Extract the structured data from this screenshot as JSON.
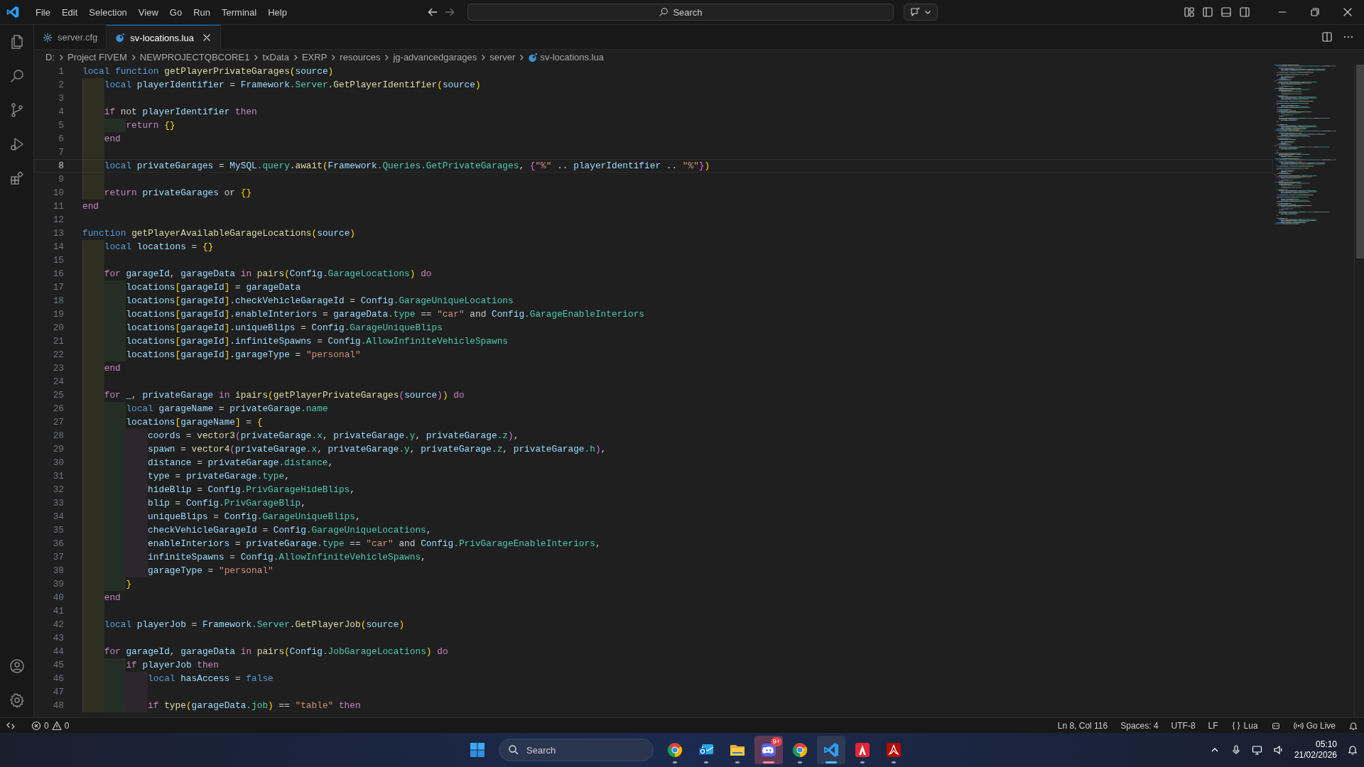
{
  "title_bar": {
    "menu": [
      "File",
      "Edit",
      "Selection",
      "View",
      "Go",
      "Run",
      "Terminal",
      "Help"
    ],
    "command_center": {
      "label": "Search"
    }
  },
  "tabs": [
    {
      "label": "server.cfg",
      "kind": "config",
      "selected": false
    },
    {
      "label": "sv-locations.lua",
      "kind": "lua",
      "selected": true
    }
  ],
  "breadcrumbs": [
    {
      "label": "D:",
      "kind": "folder"
    },
    {
      "label": "Project FIVEM",
      "kind": "folder"
    },
    {
      "label": "NEWPROJECTQBCORE1",
      "kind": "folder"
    },
    {
      "label": "txData",
      "kind": "folder"
    },
    {
      "label": "EXRP",
      "kind": "folder"
    },
    {
      "label": "resources",
      "kind": "folder"
    },
    {
      "label": "jg-advancedgarages",
      "kind": "folder"
    },
    {
      "label": "server",
      "kind": "folder"
    },
    {
      "label": "sv-locations.lua",
      "kind": "lua"
    }
  ],
  "editor": {
    "lines": [
      {
        "number": "1",
        "current": false,
        "tokens": [
          {
            "text": "local ",
            "kind": "kw"
          },
          {
            "text": "function ",
            "kind": "kw"
          },
          {
            "text": "getPlayerPrivateGarages",
            "kind": "fn"
          },
          {
            "text": "(",
            "kind": "b1"
          },
          {
            "text": "source",
            "kind": "var"
          },
          {
            "text": ")",
            "kind": "b1"
          }
        ]
      },
      {
        "number": "2",
        "current": false,
        "tokens": [
          {
            "text": "    local ",
            "kind": "kw"
          },
          {
            "text": "playerIdentifier",
            "kind": "var"
          },
          {
            "text": " = ",
            "kind": "op"
          },
          {
            "text": "Framework",
            "kind": "var"
          },
          {
            "text": ".Server",
            "kind": "prop"
          },
          {
            "text": ".GetPlayerIdentifier",
            "kind": "fn"
          },
          {
            "text": "(",
            "kind": "b1"
          },
          {
            "text": "source",
            "kind": "var"
          },
          {
            "text": ")",
            "kind": "b1"
          }
        ]
      },
      {
        "number": "3",
        "current": false
      },
      {
        "number": "4",
        "current": false,
        "tokens": [
          {
            "text": "    if ",
            "kind": "ctl"
          },
          {
            "text": "not ",
            "kind": "op"
          },
          {
            "text": "playerIdentifier ",
            "kind": "var"
          },
          {
            "text": "then",
            "kind": "ctl"
          }
        ]
      },
      {
        "number": "5",
        "current": false,
        "tokens": [
          {
            "text": "        return ",
            "kind": "ctl"
          },
          {
            "text": "{}",
            "kind": "b1"
          }
        ]
      },
      {
        "number": "6",
        "current": false,
        "tokens": [
          {
            "text": "    end",
            "kind": "ctl"
          }
        ]
      },
      {
        "number": "7",
        "current": false
      },
      {
        "number": "8",
        "current": true,
        "tokens": [
          {
            "text": "    local ",
            "kind": "kw"
          },
          {
            "text": "privateGarages",
            "kind": "var"
          },
          {
            "text": " = ",
            "kind": "op"
          },
          {
            "text": "MySQL",
            "kind": "var"
          },
          {
            "text": ".query",
            "kind": "prop"
          },
          {
            "text": ".await",
            "kind": "fn"
          },
          {
            "text": "(",
            "kind": "b1"
          },
          {
            "text": "Framework",
            "kind": "var"
          },
          {
            "text": ".Queries",
            "kind": "prop"
          },
          {
            "text": ".GetPrivateGarages",
            "kind": "prop"
          },
          {
            "text": ", ",
            "kind": "op"
          },
          {
            "text": "{",
            "kind": "b2"
          },
          {
            "text": "\"%\"",
            "kind": "str"
          },
          {
            "text": " .. ",
            "kind": "op"
          },
          {
            "text": "playerIdentifier",
            "kind": "var"
          },
          {
            "text": " .. ",
            "kind": "op"
          },
          {
            "text": "\"%\"",
            "kind": "str"
          },
          {
            "text": "}",
            "kind": "b2"
          },
          {
            "text": ")",
            "kind": "b1"
          }
        ]
      },
      {
        "number": "9",
        "current": false
      },
      {
        "number": "10",
        "current": false,
        "tokens": [
          {
            "text": "    return ",
            "kind": "ctl"
          },
          {
            "text": "privateGarages ",
            "kind": "var"
          },
          {
            "text": "or ",
            "kind": "op"
          },
          {
            "text": "{}",
            "kind": "b1"
          }
        ]
      },
      {
        "number": "11",
        "current": false,
        "tokens": [
          {
            "text": "end",
            "kind": "ctl"
          }
        ]
      },
      {
        "number": "12",
        "current": false
      },
      {
        "number": "13",
        "current": false,
        "tokens": [
          {
            "text": "function ",
            "kind": "kw"
          },
          {
            "text": "getPlayerAvailableGarageLocations",
            "kind": "fn"
          },
          {
            "text": "(",
            "kind": "b1"
          },
          {
            "text": "source",
            "kind": "var"
          },
          {
            "text": ")",
            "kind": "b1"
          }
        ]
      },
      {
        "number": "14",
        "current": false,
        "tokens": [
          {
            "text": "    local ",
            "kind": "kw"
          },
          {
            "text": "locations",
            "kind": "var"
          },
          {
            "text": " = ",
            "kind": "op"
          },
          {
            "text": "{}",
            "kind": "b1"
          }
        ]
      },
      {
        "number": "15",
        "current": false
      },
      {
        "number": "16",
        "current": false,
        "tokens": [
          {
            "text": "    for ",
            "kind": "ctl"
          },
          {
            "text": "garageId",
            "kind": "var"
          },
          {
            "text": ", ",
            "kind": "op"
          },
          {
            "text": "garageData ",
            "kind": "var"
          },
          {
            "text": "in ",
            "kind": "ctl"
          },
          {
            "text": "pairs",
            "kind": "fn"
          },
          {
            "text": "(",
            "kind": "b1"
          },
          {
            "text": "Config",
            "kind": "var"
          },
          {
            "text": ".GarageLocations",
            "kind": "prop"
          },
          {
            "text": ") ",
            "kind": "b1"
          },
          {
            "text": "do",
            "kind": "ctl"
          }
        ]
      },
      {
        "number": "17",
        "current": false,
        "tokens": [
          {
            "text": "        locations",
            "kind": "var"
          },
          {
            "text": "[",
            "kind": "b1"
          },
          {
            "text": "garageId",
            "kind": "var"
          },
          {
            "text": "]",
            "kind": "b1"
          },
          {
            "text": " = ",
            "kind": "op"
          },
          {
            "text": "garageData",
            "kind": "var"
          }
        ]
      },
      {
        "number": "18",
        "current": false,
        "tokens": [
          {
            "text": "        locations",
            "kind": "var"
          },
          {
            "text": "[",
            "kind": "b1"
          },
          {
            "text": "garageId",
            "kind": "var"
          },
          {
            "text": "]",
            "kind": "b1"
          },
          {
            "text": ".checkVehicleGarageId",
            "kind": "var"
          },
          {
            "text": " = ",
            "kind": "op"
          },
          {
            "text": "Config",
            "kind": "var"
          },
          {
            "text": ".GarageUniqueLocations",
            "kind": "prop"
          }
        ]
      },
      {
        "number": "19",
        "current": false,
        "tokens": [
          {
            "text": "        locations",
            "kind": "var"
          },
          {
            "text": "[",
            "kind": "b1"
          },
          {
            "text": "garageId",
            "kind": "var"
          },
          {
            "text": "]",
            "kind": "b1"
          },
          {
            "text": ".enableInteriors",
            "kind": "var"
          },
          {
            "text": " = ",
            "kind": "op"
          },
          {
            "text": "garageData",
            "kind": "var"
          },
          {
            "text": ".type",
            "kind": "prop"
          },
          {
            "text": " == ",
            "kind": "op"
          },
          {
            "text": "\"car\"",
            "kind": "str"
          },
          {
            "text": " and ",
            "kind": "op"
          },
          {
            "text": "Config",
            "kind": "var"
          },
          {
            "text": ".GarageEnableInteriors",
            "kind": "prop"
          }
        ]
      },
      {
        "number": "20",
        "current": false,
        "tokens": [
          {
            "text": "        locations",
            "kind": "var"
          },
          {
            "text": "[",
            "kind": "b1"
          },
          {
            "text": "garageId",
            "kind": "var"
          },
          {
            "text": "]",
            "kind": "b1"
          },
          {
            "text": ".uniqueBlips",
            "kind": "var"
          },
          {
            "text": " = ",
            "kind": "op"
          },
          {
            "text": "Config",
            "kind": "var"
          },
          {
            "text": ".GarageUniqueBlips",
            "kind": "prop"
          }
        ]
      },
      {
        "number": "21",
        "current": false,
        "tokens": [
          {
            "text": "        locations",
            "kind": "var"
          },
          {
            "text": "[",
            "kind": "b1"
          },
          {
            "text": "garageId",
            "kind": "var"
          },
          {
            "text": "]",
            "kind": "b1"
          },
          {
            "text": ".infiniteSpawns",
            "kind": "var"
          },
          {
            "text": " = ",
            "kind": "op"
          },
          {
            "text": "Config",
            "kind": "var"
          },
          {
            "text": ".AllowInfiniteVehicleSpawns",
            "kind": "prop"
          }
        ]
      },
      {
        "number": "22",
        "current": false,
        "tokens": [
          {
            "text": "        locations",
            "kind": "var"
          },
          {
            "text": "[",
            "kind": "b1"
          },
          {
            "text": "garageId",
            "kind": "var"
          },
          {
            "text": "]",
            "kind": "b1"
          },
          {
            "text": ".garageType",
            "kind": "var"
          },
          {
            "text": " = ",
            "kind": "op"
          },
          {
            "text": "\"personal\"",
            "kind": "str"
          }
        ]
      },
      {
        "number": "23",
        "current": false,
        "tokens": [
          {
            "text": "    end",
            "kind": "ctl"
          }
        ]
      },
      {
        "number": "24",
        "current": false
      },
      {
        "number": "25",
        "current": false,
        "tokens": [
          {
            "text": "    for ",
            "kind": "ctl"
          },
          {
            "text": "_",
            "kind": "var"
          },
          {
            "text": ", ",
            "kind": "op"
          },
          {
            "text": "privateGarage ",
            "kind": "var"
          },
          {
            "text": "in ",
            "kind": "ctl"
          },
          {
            "text": "ipairs",
            "kind": "fn"
          },
          {
            "text": "(",
            "kind": "b1"
          },
          {
            "text": "getPlayerPrivateGarages",
            "kind": "fn"
          },
          {
            "text": "(",
            "kind": "b2"
          },
          {
            "text": "source",
            "kind": "var"
          },
          {
            "text": ")",
            "kind": "b2"
          },
          {
            "text": ") ",
            "kind": "b1"
          },
          {
            "text": "do",
            "kind": "ctl"
          }
        ]
      },
      {
        "number": "26",
        "current": false,
        "tokens": [
          {
            "text": "        local ",
            "kind": "kw"
          },
          {
            "text": "garageName",
            "kind": "var"
          },
          {
            "text": " = ",
            "kind": "op"
          },
          {
            "text": "privateGarage",
            "kind": "var"
          },
          {
            "text": ".name",
            "kind": "prop"
          }
        ]
      },
      {
        "number": "27",
        "current": false,
        "tokens": [
          {
            "text": "        locations",
            "kind": "var"
          },
          {
            "text": "[",
            "kind": "b1"
          },
          {
            "text": "garageName",
            "kind": "var"
          },
          {
            "text": "]",
            "kind": "b1"
          },
          {
            "text": " = ",
            "kind": "op"
          },
          {
            "text": "{",
            "kind": "b1"
          }
        ]
      },
      {
        "number": "28",
        "current": false,
        "tokens": [
          {
            "text": "            coords",
            "kind": "var"
          },
          {
            "text": " = ",
            "kind": "op"
          },
          {
            "text": "vector3",
            "kind": "fn"
          },
          {
            "text": "(",
            "kind": "b2"
          },
          {
            "text": "privateGarage",
            "kind": "var"
          },
          {
            "text": ".x",
            "kind": "prop"
          },
          {
            "text": ", ",
            "kind": "op"
          },
          {
            "text": "privateGarage",
            "kind": "var"
          },
          {
            "text": ".y",
            "kind": "prop"
          },
          {
            "text": ", ",
            "kind": "op"
          },
          {
            "text": "privateGarage",
            "kind": "var"
          },
          {
            "text": ".z",
            "kind": "prop"
          },
          {
            "text": ")",
            "kind": "b2"
          },
          {
            "text": ",",
            "kind": "op"
          }
        ]
      },
      {
        "number": "29",
        "current": false,
        "tokens": [
          {
            "text": "            spawn",
            "kind": "var"
          },
          {
            "text": " = ",
            "kind": "op"
          },
          {
            "text": "vector4",
            "kind": "fn"
          },
          {
            "text": "(",
            "kind": "b2"
          },
          {
            "text": "privateGarage",
            "kind": "var"
          },
          {
            "text": ".x",
            "kind": "prop"
          },
          {
            "text": ", ",
            "kind": "op"
          },
          {
            "text": "privateGarage",
            "kind": "var"
          },
          {
            "text": ".y",
            "kind": "prop"
          },
          {
            "text": ", ",
            "kind": "op"
          },
          {
            "text": "privateGarage",
            "kind": "var"
          },
          {
            "text": ".z",
            "kind": "prop"
          },
          {
            "text": ", ",
            "kind": "op"
          },
          {
            "text": "privateGarage",
            "kind": "var"
          },
          {
            "text": ".h",
            "kind": "prop"
          },
          {
            "text": ")",
            "kind": "b2"
          },
          {
            "text": ",",
            "kind": "op"
          }
        ]
      },
      {
        "number": "30",
        "current": false,
        "tokens": [
          {
            "text": "            distance",
            "kind": "var"
          },
          {
            "text": " = ",
            "kind": "op"
          },
          {
            "text": "privateGarage",
            "kind": "var"
          },
          {
            "text": ".distance",
            "kind": "prop"
          },
          {
            "text": ",",
            "kind": "op"
          }
        ]
      },
      {
        "number": "31",
        "current": false,
        "tokens": [
          {
            "text": "            type",
            "kind": "var"
          },
          {
            "text": " = ",
            "kind": "op"
          },
          {
            "text": "privateGarage",
            "kind": "var"
          },
          {
            "text": ".type",
            "kind": "prop"
          },
          {
            "text": ",",
            "kind": "op"
          }
        ]
      },
      {
        "number": "32",
        "current": false,
        "tokens": [
          {
            "text": "            hideBlip",
            "kind": "var"
          },
          {
            "text": " = ",
            "kind": "op"
          },
          {
            "text": "Config",
            "kind": "var"
          },
          {
            "text": ".PrivGarageHideBlips",
            "kind": "prop"
          },
          {
            "text": ",",
            "kind": "op"
          }
        ]
      },
      {
        "number": "33",
        "current": false,
        "tokens": [
          {
            "text": "            blip",
            "kind": "var"
          },
          {
            "text": " = ",
            "kind": "op"
          },
          {
            "text": "Config",
            "kind": "var"
          },
          {
            "text": ".PrivGarageBlip",
            "kind": "prop"
          },
          {
            "text": ",",
            "kind": "op"
          }
        ]
      },
      {
        "number": "34",
        "current": false,
        "tokens": [
          {
            "text": "            uniqueBlips",
            "kind": "var"
          },
          {
            "text": " = ",
            "kind": "op"
          },
          {
            "text": "Config",
            "kind": "var"
          },
          {
            "text": ".GarageUniqueBlips",
            "kind": "prop"
          },
          {
            "text": ",",
            "kind": "op"
          }
        ]
      },
      {
        "number": "35",
        "current": false,
        "tokens": [
          {
            "text": "            checkVehicleGarageId",
            "kind": "var"
          },
          {
            "text": " = ",
            "kind": "op"
          },
          {
            "text": "Config",
            "kind": "var"
          },
          {
            "text": ".GarageUniqueLocations",
            "kind": "prop"
          },
          {
            "text": ",",
            "kind": "op"
          }
        ]
      },
      {
        "number": "36",
        "current": false,
        "tokens": [
          {
            "text": "            enableInteriors",
            "kind": "var"
          },
          {
            "text": " = ",
            "kind": "op"
          },
          {
            "text": "privateGarage",
            "kind": "var"
          },
          {
            "text": ".type",
            "kind": "prop"
          },
          {
            "text": " == ",
            "kind": "op"
          },
          {
            "text": "\"car\"",
            "kind": "str"
          },
          {
            "text": " and ",
            "kind": "op"
          },
          {
            "text": "Config",
            "kind": "var"
          },
          {
            "text": ".PrivGarageEnableInteriors",
            "kind": "prop"
          },
          {
            "text": ",",
            "kind": "op"
          }
        ]
      },
      {
        "number": "37",
        "current": false,
        "tokens": [
          {
            "text": "            infiniteSpawns",
            "kind": "var"
          },
          {
            "text": " = ",
            "kind": "op"
          },
          {
            "text": "Config",
            "kind": "var"
          },
          {
            "text": ".AllowInfiniteVehicleSpawns",
            "kind": "prop"
          },
          {
            "text": ",",
            "kind": "op"
          }
        ]
      },
      {
        "number": "38",
        "current": false,
        "tokens": [
          {
            "text": "            garageType",
            "kind": "var"
          },
          {
            "text": " = ",
            "kind": "op"
          },
          {
            "text": "\"personal\"",
            "kind": "str"
          }
        ]
      },
      {
        "number": "39",
        "current": false,
        "tokens": [
          {
            "text": "        }",
            "kind": "b1"
          }
        ]
      },
      {
        "number": "40",
        "current": false,
        "tokens": [
          {
            "text": "    end",
            "kind": "ctl"
          }
        ]
      },
      {
        "number": "41",
        "current": false
      },
      {
        "number": "42",
        "current": false,
        "tokens": [
          {
            "text": "    local ",
            "kind": "kw"
          },
          {
            "text": "playerJob",
            "kind": "var"
          },
          {
            "text": " = ",
            "kind": "op"
          },
          {
            "text": "Framework",
            "kind": "var"
          },
          {
            "text": ".Server",
            "kind": "prop"
          },
          {
            "text": ".GetPlayerJob",
            "kind": "fn"
          },
          {
            "text": "(",
            "kind": "b1"
          },
          {
            "text": "source",
            "kind": "var"
          },
          {
            "text": ")",
            "kind": "b1"
          }
        ]
      },
      {
        "number": "43",
        "current": false
      },
      {
        "number": "44",
        "current": false,
        "tokens": [
          {
            "text": "    for ",
            "kind": "ctl"
          },
          {
            "text": "garageId",
            "kind": "var"
          },
          {
            "text": ", ",
            "kind": "op"
          },
          {
            "text": "garageData ",
            "kind": "var"
          },
          {
            "text": "in ",
            "kind": "ctl"
          },
          {
            "text": "pairs",
            "kind": "fn"
          },
          {
            "text": "(",
            "kind": "b1"
          },
          {
            "text": "Config",
            "kind": "var"
          },
          {
            "text": ".JobGarageLocations",
            "kind": "prop"
          },
          {
            "text": ") ",
            "kind": "b1"
          },
          {
            "text": "do",
            "kind": "ctl"
          }
        ]
      },
      {
        "number": "45",
        "current": false,
        "tokens": [
          {
            "text": "        if ",
            "kind": "ctl"
          },
          {
            "text": "playerJob ",
            "kind": "var"
          },
          {
            "text": "then",
            "kind": "ctl"
          }
        ]
      },
      {
        "number": "46",
        "current": false,
        "tokens": [
          {
            "text": "            local ",
            "kind": "kw"
          },
          {
            "text": "hasAccess",
            "kind": "var"
          },
          {
            "text": " = ",
            "kind": "op"
          },
          {
            "text": "false",
            "kind": "kw"
          }
        ]
      },
      {
        "number": "47",
        "current": false
      },
      {
        "number": "48",
        "current": false,
        "tokens": [
          {
            "text": "            if ",
            "kind": "ctl"
          },
          {
            "text": "type",
            "kind": "fn"
          },
          {
            "text": "(",
            "kind": "b1"
          },
          {
            "text": "garageData",
            "kind": "var"
          },
          {
            "text": ".job",
            "kind": "prop"
          },
          {
            "text": ") ",
            "kind": "b1"
          },
          {
            "text": "== ",
            "kind": "op"
          },
          {
            "text": "\"table\" ",
            "kind": "str"
          },
          {
            "text": "then",
            "kind": "ctl"
          }
        ]
      }
    ]
  },
  "status_bar": {
    "errors": "0",
    "warnings": "0",
    "items": [
      {
        "kind": "text",
        "label": "Ln 8, Col 116"
      },
      {
        "kind": "text",
        "label": "Spaces: 4"
      },
      {
        "kind": "text",
        "label": "UTF-8"
      },
      {
        "kind": "text",
        "label": "LF"
      },
      {
        "kind": "language",
        "label": "Lua"
      },
      {
        "kind": "copilot"
      },
      {
        "kind": "live",
        "label": "Go Live"
      },
      {
        "kind": "bell"
      }
    ]
  },
  "taskbar": {
    "search": {
      "label": "Search"
    },
    "apps": [
      {
        "kind": "chrome",
        "active": false,
        "attention": false
      },
      {
        "kind": "mail",
        "active": false,
        "attention": false
      },
      {
        "kind": "folder",
        "active": false,
        "attention": false
      },
      {
        "kind": "discord",
        "active": false,
        "attention": true,
        "badge": "9+"
      },
      {
        "kind": "chrome",
        "active": false,
        "attention": false
      },
      {
        "kind": "vscode",
        "active": true,
        "attention": false
      },
      {
        "kind": "red-a",
        "active": false,
        "attention": false
      },
      {
        "kind": "red-b",
        "active": false,
        "attention": false
      }
    ],
    "clock": {
      "time": "05:10",
      "date": "21/02/2026"
    }
  }
}
